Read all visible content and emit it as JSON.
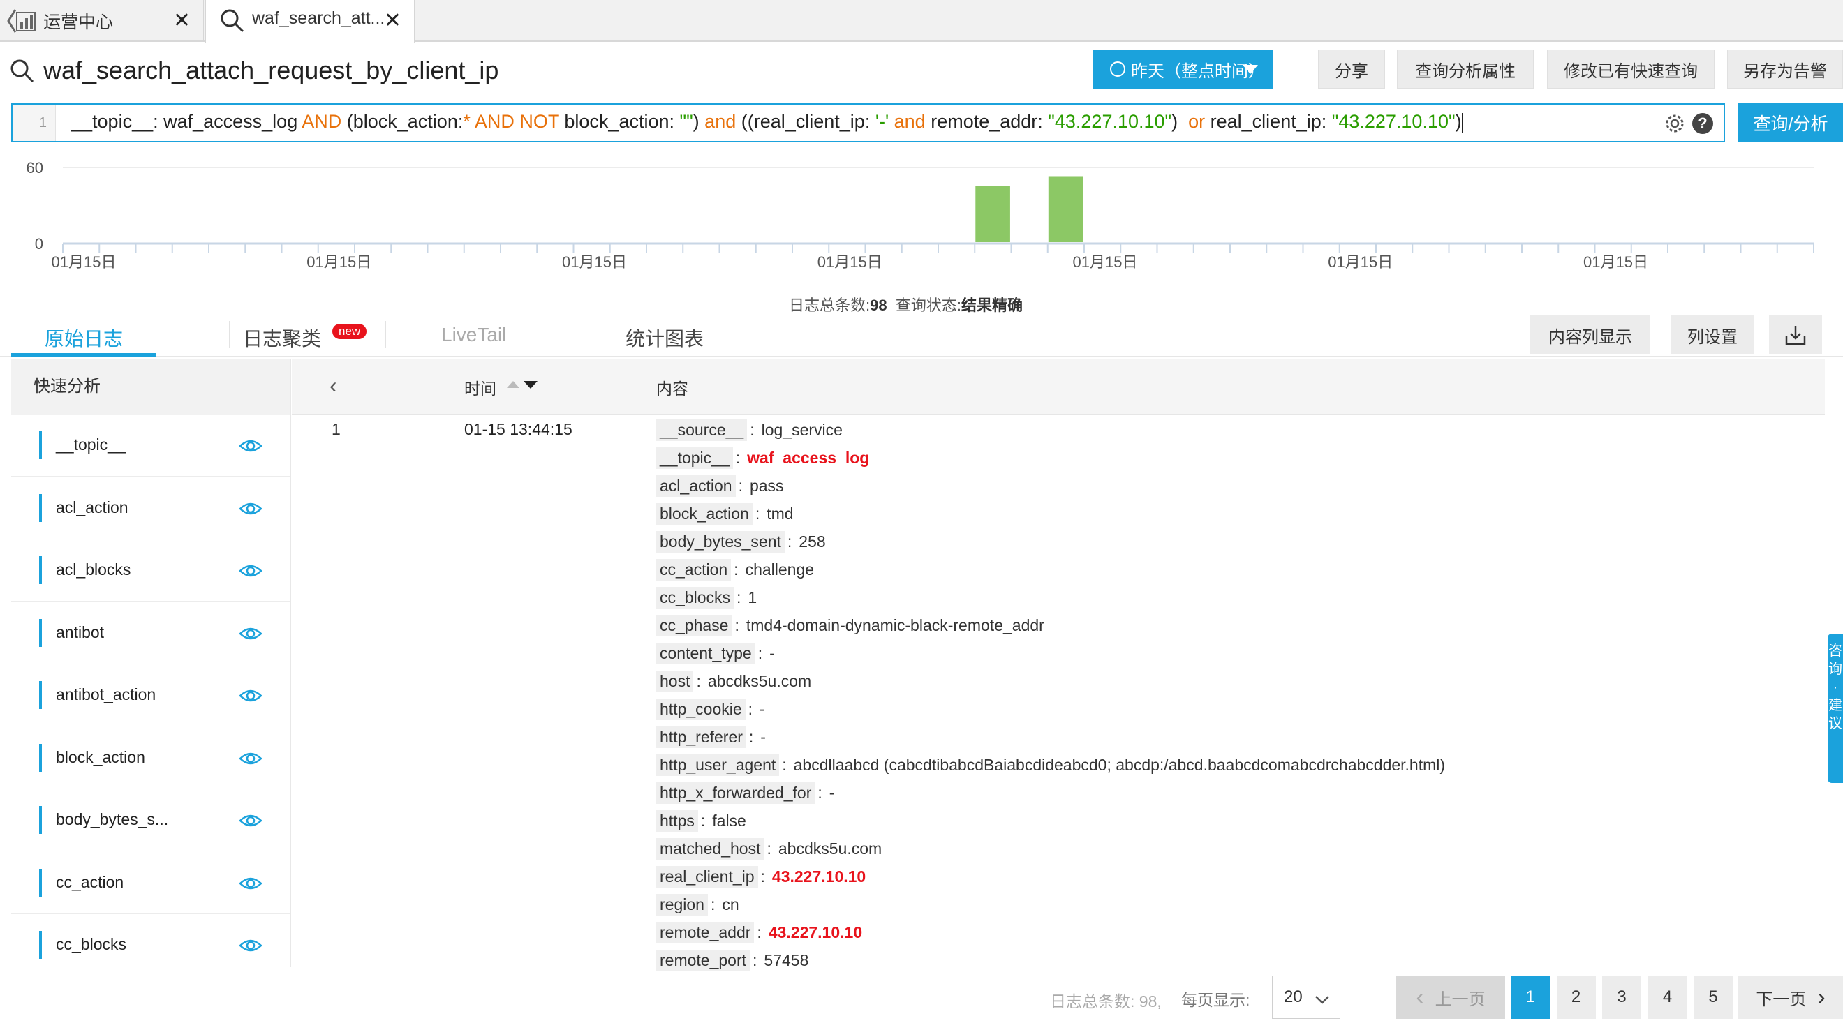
{
  "browser_tabs": [
    {
      "label": "运营中心",
      "close": "✕"
    },
    {
      "label": "waf_search_att...",
      "close": "✕"
    }
  ],
  "header": {
    "title": "waf_search_attach_request_by_client_ip",
    "time_range": "昨天（整点时间）",
    "share": "分享",
    "query_props": "查询分析属性",
    "edit_quick_query": "修改已有快速查询",
    "save_alert": "另存为告警"
  },
  "query": {
    "line_number": "1",
    "tokens": [
      {
        "t": "__topic__: waf_access_log ",
        "c": ""
      },
      {
        "t": "AND ",
        "c": "kw"
      },
      {
        "t": "(block_action:",
        "c": ""
      },
      {
        "t": "* ",
        "c": "kw"
      },
      {
        "t": "AND NOT ",
        "c": "kw"
      },
      {
        "t": "block_action: ",
        "c": ""
      },
      {
        "t": "\"\"",
        "c": "str"
      },
      {
        "t": ") ",
        "c": ""
      },
      {
        "t": "and ",
        "c": "kw"
      },
      {
        "t": "((real_client_ip: ",
        "c": ""
      },
      {
        "t": "'-' ",
        "c": "str"
      },
      {
        "t": "and ",
        "c": "kw"
      },
      {
        "t": "remote_addr: ",
        "c": ""
      },
      {
        "t": "\"43.227.10.10\"",
        "c": "str"
      },
      {
        "t": ")  ",
        "c": ""
      },
      {
        "t": "or ",
        "c": "kw"
      },
      {
        "t": "real_client_ip: ",
        "c": ""
      },
      {
        "t": "\"43.227.10.10\"",
        "c": "str"
      },
      {
        "t": ")",
        "c": ""
      }
    ],
    "search_button": "查询/分析"
  },
  "chart_data": {
    "type": "bar",
    "y_ticks": [
      "60",
      "0"
    ],
    "ylim": [
      0,
      60
    ],
    "x_tick_labels": [
      "01月15日",
      "01月15日",
      "01月15日",
      "01月15日",
      "01月15日",
      "01月15日",
      "01月15日"
    ],
    "bars": [
      {
        "slot": 25,
        "value": 45
      },
      {
        "slot": 27,
        "value": 53
      }
    ],
    "slots": 48,
    "bar_color": "#8cc865"
  },
  "summary": {
    "total_label": "日志总条数:",
    "total_value": "98",
    "status_label": "查询状态:",
    "status_value": "结果精确"
  },
  "content_tabs": {
    "raw": "原始日志",
    "cluster": "日志聚类",
    "new_badge": "new",
    "livetail": "LiveTail",
    "charts": "统计图表",
    "content_col": "内容列显示",
    "col_settings": "列设置"
  },
  "left_panel": {
    "title": "快速分析",
    "fields": [
      "__topic__",
      "acl_action",
      "acl_blocks",
      "antibot",
      "antibot_action",
      "block_action",
      "body_bytes_s...",
      "cc_action",
      "cc_blocks"
    ]
  },
  "table": {
    "col_time": "时间",
    "col_content": "内容",
    "row": {
      "index": "1",
      "time": "01-15 13:44:15",
      "fields": [
        {
          "k": "__source__",
          "v": "log_service",
          "red": false
        },
        {
          "k": "__topic__",
          "v": "waf_access_log",
          "red": true
        },
        {
          "k": "acl_action",
          "v": "pass",
          "red": false
        },
        {
          "k": "block_action",
          "v": "tmd",
          "red": false
        },
        {
          "k": "body_bytes_sent",
          "v": "258",
          "red": false
        },
        {
          "k": "cc_action",
          "v": "challenge",
          "red": false
        },
        {
          "k": "cc_blocks",
          "v": "1",
          "red": false
        },
        {
          "k": "cc_phase",
          "v": "tmd4-domain-dynamic-black-remote_addr",
          "red": false
        },
        {
          "k": "content_type",
          "v": "-",
          "red": false
        },
        {
          "k": "host",
          "v": "abcdks5u.com",
          "red": false
        },
        {
          "k": "http_cookie",
          "v": "-",
          "red": false
        },
        {
          "k": "http_referer",
          "v": "-",
          "red": false
        },
        {
          "k": "http_user_agent",
          "v": "abcdllaabcd (cabcdtibabcdBaiabcdideabcd0; abcdp:/abcd.baabcdcomabcdrchabcdder.html)",
          "red": false
        },
        {
          "k": "http_x_forwarded_for",
          "v": "-",
          "red": false
        },
        {
          "k": "https",
          "v": "false",
          "red": false
        },
        {
          "k": "matched_host",
          "v": "abcdks5u.com",
          "red": false
        },
        {
          "k": "real_client_ip",
          "v": "43.227.10.10",
          "red": true
        },
        {
          "k": "region",
          "v": "cn",
          "red": false
        },
        {
          "k": "remote_addr",
          "v": "43.227.10.10",
          "red": true
        },
        {
          "k": "remote_port",
          "v": "57458",
          "red": false
        }
      ]
    }
  },
  "feedback": "咨询·建议",
  "pagination": {
    "total": "日志总条数: 98,",
    "per_page_label": "每页显示:",
    "per_page": "20",
    "prev": "上一页",
    "pages": [
      "1",
      "2",
      "3",
      "4",
      "5"
    ],
    "current": "1",
    "next": "下一页"
  }
}
